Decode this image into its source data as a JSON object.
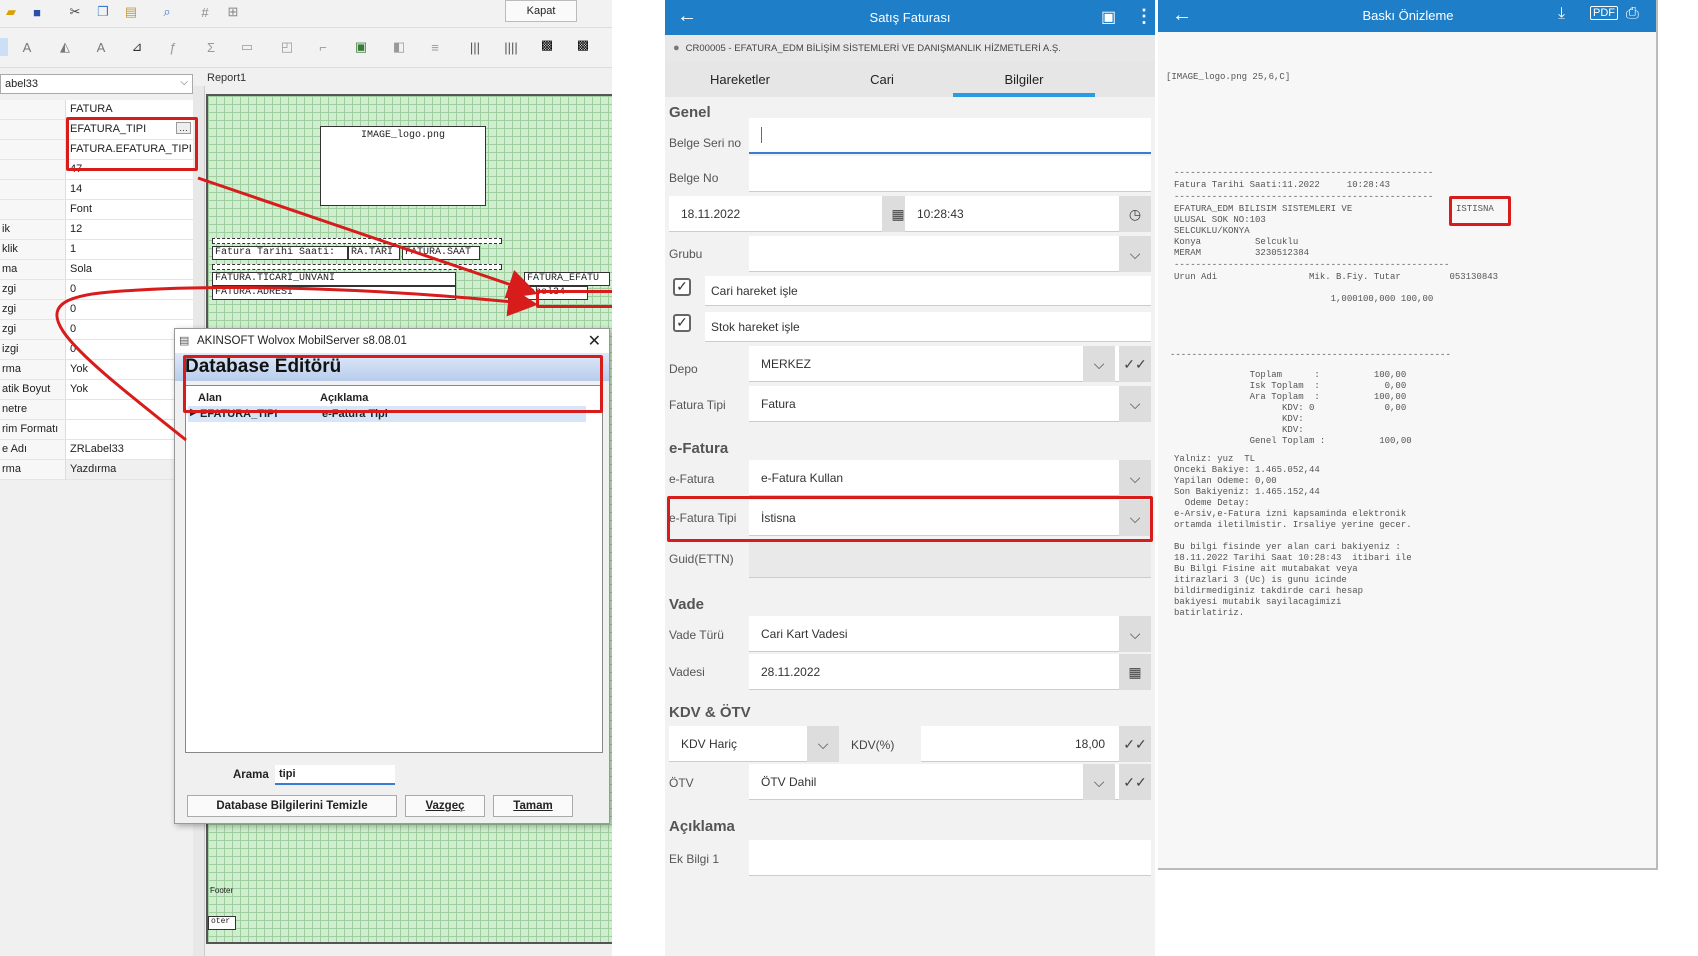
{
  "designer": {
    "kapat_label": "Kapat",
    "combo_value": "abel33",
    "report_tab": "Report1",
    "props": [
      {
        "k": "",
        "v": "FATURA"
      },
      {
        "k": "",
        "v": "EFATURA_TIPI"
      },
      {
        "k": "",
        "v": "FATURA.EFATURA_TIPI"
      },
      {
        "k": "",
        "v": "47"
      },
      {
        "k": "",
        "v": "14"
      },
      {
        "k": "",
        "v": "Font"
      },
      {
        "k": "ik",
        "v": "12"
      },
      {
        "k": "klik",
        "v": "1"
      },
      {
        "k": "ma",
        "v": "Sola"
      },
      {
        "k": "zgi",
        "v": "0"
      },
      {
        "k": "zgi",
        "v": "0"
      },
      {
        "k": "zgi",
        "v": "0"
      },
      {
        "k": "izgi",
        "v": "0"
      },
      {
        "k": "rma",
        "v": "Yok"
      },
      {
        "k": "atik Boyut",
        "v": "Yok"
      },
      {
        "k": "netre",
        "v": ""
      },
      {
        "k": "rim Formatı",
        "v": ""
      },
      {
        "k": "e Adı",
        "v": "ZRLabel33"
      },
      {
        "k": "rma",
        "v": "Yazdırma"
      }
    ],
    "canvas": {
      "logo": "IMAGE_logo.png",
      "line1": "Fatura Tarihi Saati:",
      "line1b": "RA.TARI",
      "line1c": "FATURA.SAAT",
      "line2": "FATURA.TICARI_UNVANI",
      "line3": "FATURA.ADRESI",
      "efatu": "FATURA_EFATU",
      "zrlabel": "ZRLabel34",
      "pa": "PA",
      "footer": "Footer",
      "footer2": "oter"
    },
    "dialog": {
      "title": "AKINSOFT Wolvox MobilServer s8.08.01",
      "heading": "Database Editörü",
      "col_alan": "Alan",
      "col_aciklama": "Açıklama",
      "row_alan": "EFATURA_TIPI",
      "row_aciklama": "e-Fatura Tipi",
      "search_label": "Arama",
      "search_value": "tipi",
      "btn_clear": "Database Bilgilerini Temizle",
      "btn_cancel": "Vazgeç",
      "btn_ok": "Tamam"
    }
  },
  "mobile": {
    "title": "Satış Faturası",
    "subtitle": "CR00005 - EFATURA_EDM BİLİŞİM SİSTEMLERİ VE DANIŞMANLIK HİZMETLERİ A.Ş.",
    "tabs": [
      "Hareketler",
      "Cari",
      "Bilgiler"
    ],
    "sec_genel": "Genel",
    "belge_seri_label": "Belge Seri no",
    "belge_no_label": "Belge No",
    "date": "18.11.2022",
    "time": "10:28:43",
    "grubu_label": "Grubu",
    "cari_hareket": "Cari hareket işle",
    "stok_hareket": "Stok hareket işle",
    "depo_label": "Depo",
    "depo_value": "MERKEZ",
    "fatura_tipi_label": "Fatura Tipi",
    "fatura_tipi_value": "Fatura",
    "sec_efatura": "e-Fatura",
    "efatura_label": "e-Fatura",
    "efatura_value": "e-Fatura Kullan",
    "efatura_tipi_label": "e-Fatura Tipi",
    "efatura_tipi_value": "İstisna",
    "guid_label": "Guid(ETTN)",
    "sec_vade": "Vade",
    "vade_turu_label": "Vade Türü",
    "vade_turu_value": "Cari Kart Vadesi",
    "vadesi_label": "Vadesi",
    "vadesi_value": "28.11.2022",
    "sec_kdv": "KDV & ÖTV",
    "kdv_haric": "KDV Hariç",
    "kdv_pct_label": "KDV(%)",
    "kdv_pct_value": "18,00",
    "otv_label": "ÖTV",
    "otv_value": "ÖTV Dahil",
    "sec_aciklama": "Açıklama",
    "ek_bilgi_label": "Ek Bilgi 1"
  },
  "preview": {
    "title": "Baskı Önizleme",
    "logo_text": "[IMAGE_logo.png 25,6,C]",
    "dash1": "------------------------------------------------",
    "fatura_tarihi": "Fatura Tarihi Saati:11.2022     10:28:43",
    "dash2": "------------------------------------------------",
    "company": "EFATURA_EDM BILISIM SISTEMLERI VE\nULUSAL SOK NO:103\nSELCUKLU/KONYA\nKonya          Selcuklu\nMERAM          3230512384",
    "istisna": "ISTISNA",
    "dash3": "---------------------------------------------------",
    "urun_head": "Urun Adi                 Mik. B.Fiy. Tutar         053130843",
    "urun_line": "                             1,000100,000 100,00",
    "dash4": "----------------------------------------------------",
    "totals": "              Toplam      :          100,00\n              Isk Toplam  :            0,00\n              Ara Toplam  :          100,00\n                    KDV: 0             0,00\n                    KDV:\n                    KDV:\n              Genel Toplam :          100,00",
    "footer_text": "Yalniz: yuz  TL\nOnceki Bakiye: 1.465.052,44\nYapilan Odeme: 0,00\nSon Bakiyeniz: 1.465.152,44\n  Odeme Detay:\ne-Arsiv,e-Fatura izni kapsaminda elektronik\nortamda iletilmistir. Irsaliye yerine gecer.\n\nBu bilgi fisinde yer alan cari bakiyeniz :\n18.11.2022 Tarihi Saat 10:28:43  itibari ile\nBu Bilgi Fisine ait mutabakat veya\nitirazlari 3 (Uc) is gunu icinde\nbildirmediginiz takdirde cari hesap\nbakiyesi mutabik sayilacagimizi\nbatirlatiriz."
  },
  "colors": {
    "accent": "#1e7ec8",
    "highlight": "#d81b1b",
    "tab_indicator": "#2a9be0"
  }
}
